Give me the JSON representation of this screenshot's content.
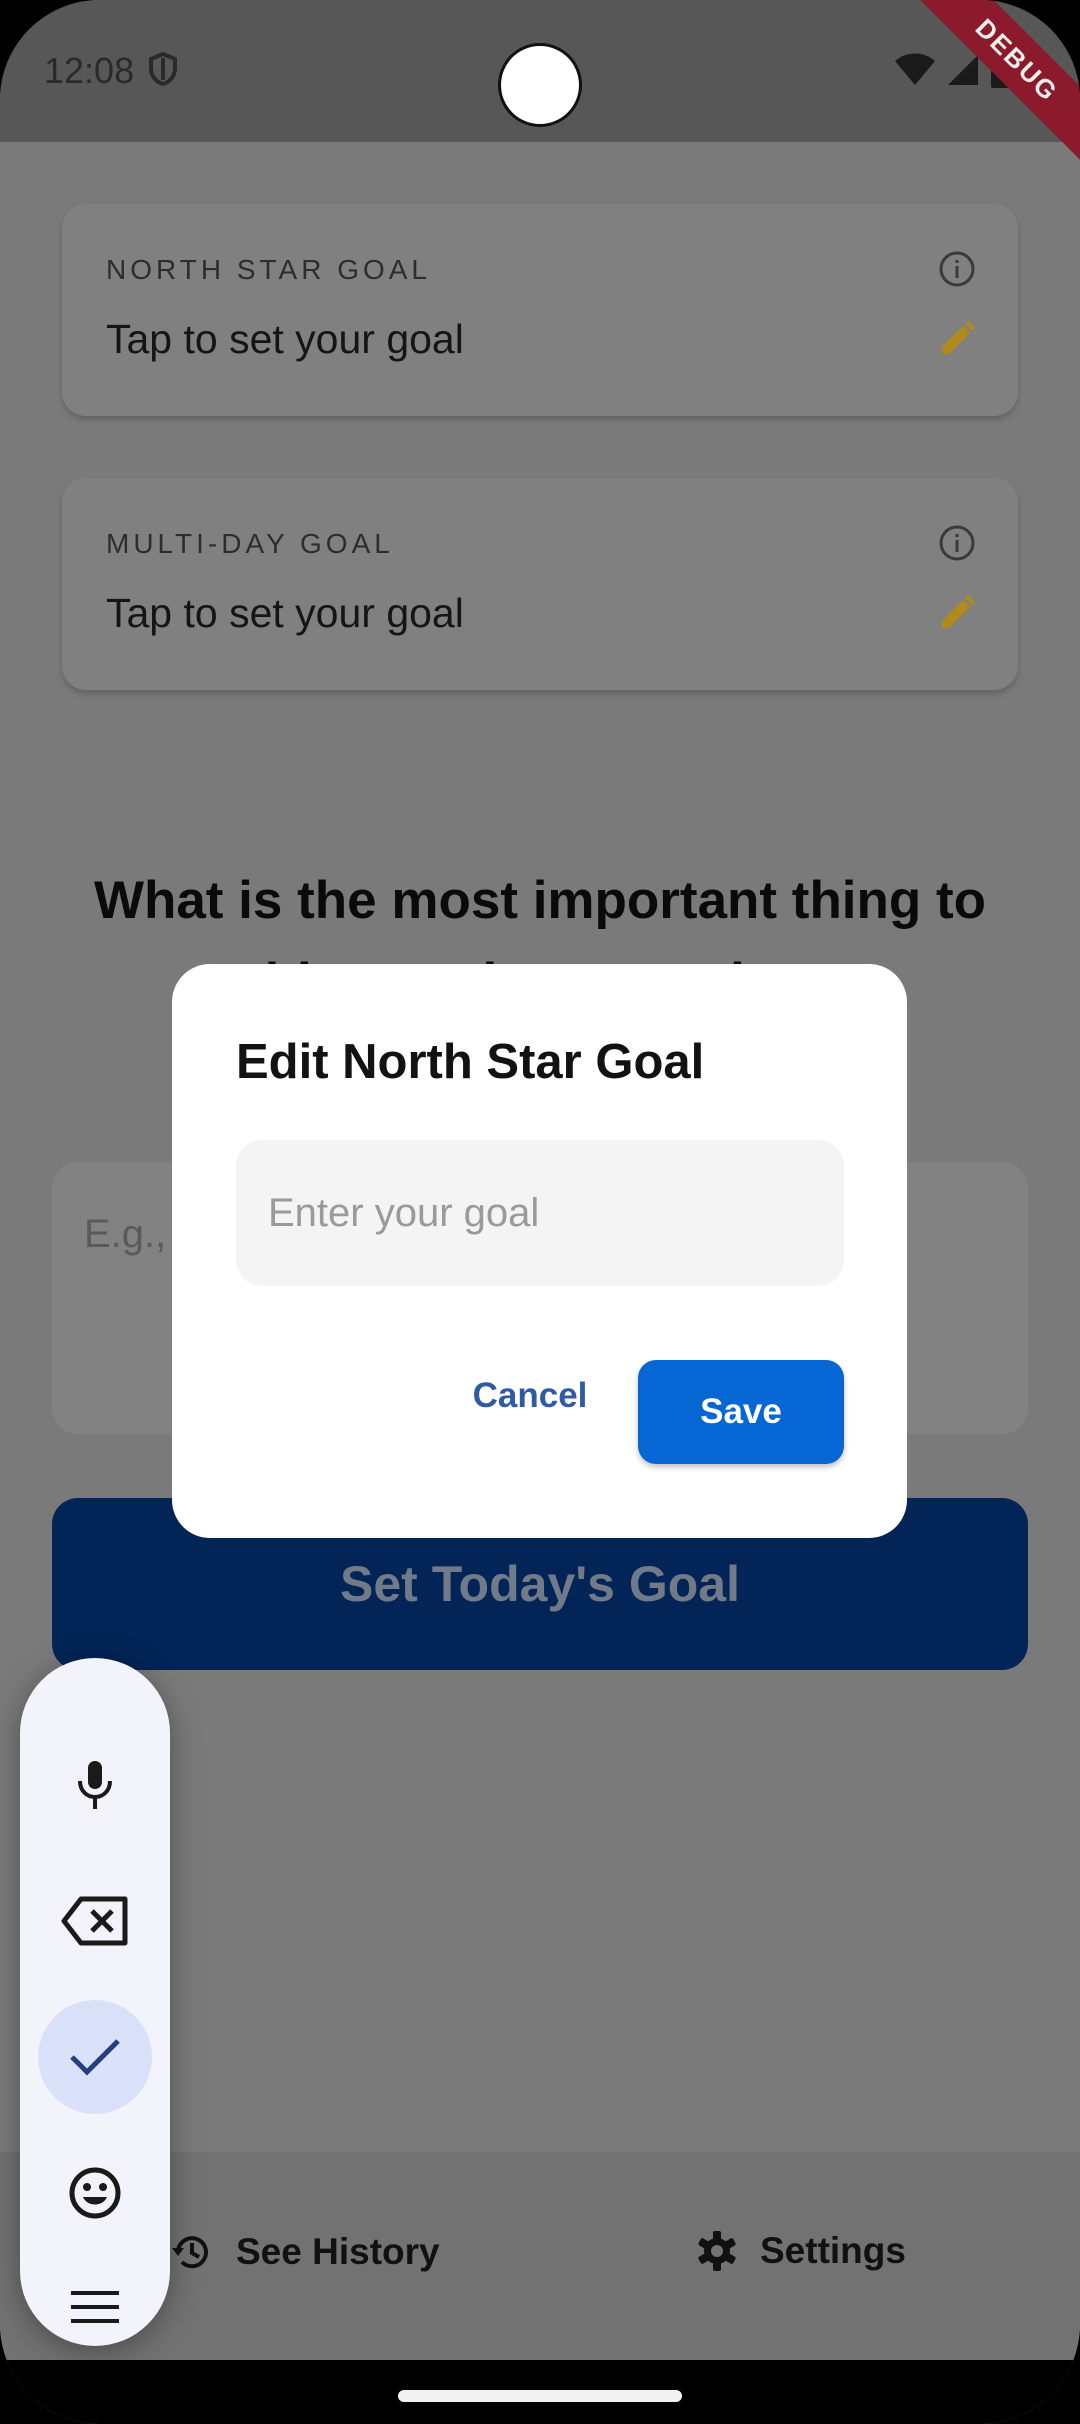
{
  "status_bar": {
    "time": "12:08",
    "debug_label": "DEBUG"
  },
  "cards": [
    {
      "label": "NORTH STAR GOAL",
      "text": "Tap to set your goal"
    },
    {
      "label": "MULTI-DAY GOAL",
      "text": "Tap to set your goal"
    }
  ],
  "main": {
    "question": "What is the most important thing to achieve today toward your",
    "input_placeholder": "E.g., ",
    "set_goal_label": "Set Today's Goal"
  },
  "bottom_nav": {
    "history_label": "See History",
    "settings_label": "Settings"
  },
  "dialog": {
    "title": "Edit North Star Goal",
    "input_placeholder": "Enter your goal",
    "input_value": "",
    "cancel_label": "Cancel",
    "save_label": "Save"
  },
  "keyboard_toolbar": {
    "items": [
      "mic-icon",
      "backspace-icon",
      "check-icon",
      "emoji-icon",
      "menu-icon"
    ],
    "active_item": "check-icon"
  },
  "colors": {
    "accent": "#0566d4",
    "primary_button": "#022456",
    "edit_icon": "#b08a1a",
    "debug_ribbon": "#8a1a2c"
  }
}
